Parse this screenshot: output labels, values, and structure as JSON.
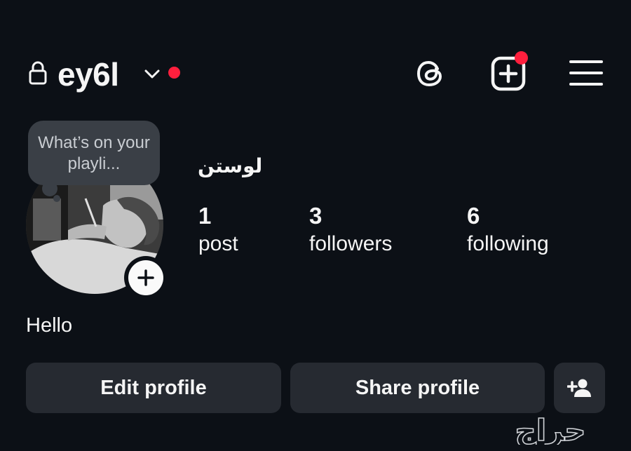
{
  "header": {
    "username": "ey6l",
    "icons": [
      "lock-icon",
      "chevron-down-icon",
      "threads-icon",
      "create-post-icon",
      "menu-icon"
    ]
  },
  "note": {
    "text": "What’s on your playli..."
  },
  "profile": {
    "display_name": "لوستن",
    "bio": "Hello",
    "stats": [
      {
        "number": "1",
        "label": "post"
      },
      {
        "number": "3",
        "label": "followers"
      },
      {
        "number": "6",
        "label": "following"
      }
    ]
  },
  "buttons": {
    "edit_profile": "Edit profile",
    "share_profile": "Share profile"
  },
  "watermark": "حراج",
  "colors": {
    "background": "#0c1016",
    "button": "#262a31",
    "notification": "#ff1f3d",
    "text": "#f5f5f5"
  }
}
